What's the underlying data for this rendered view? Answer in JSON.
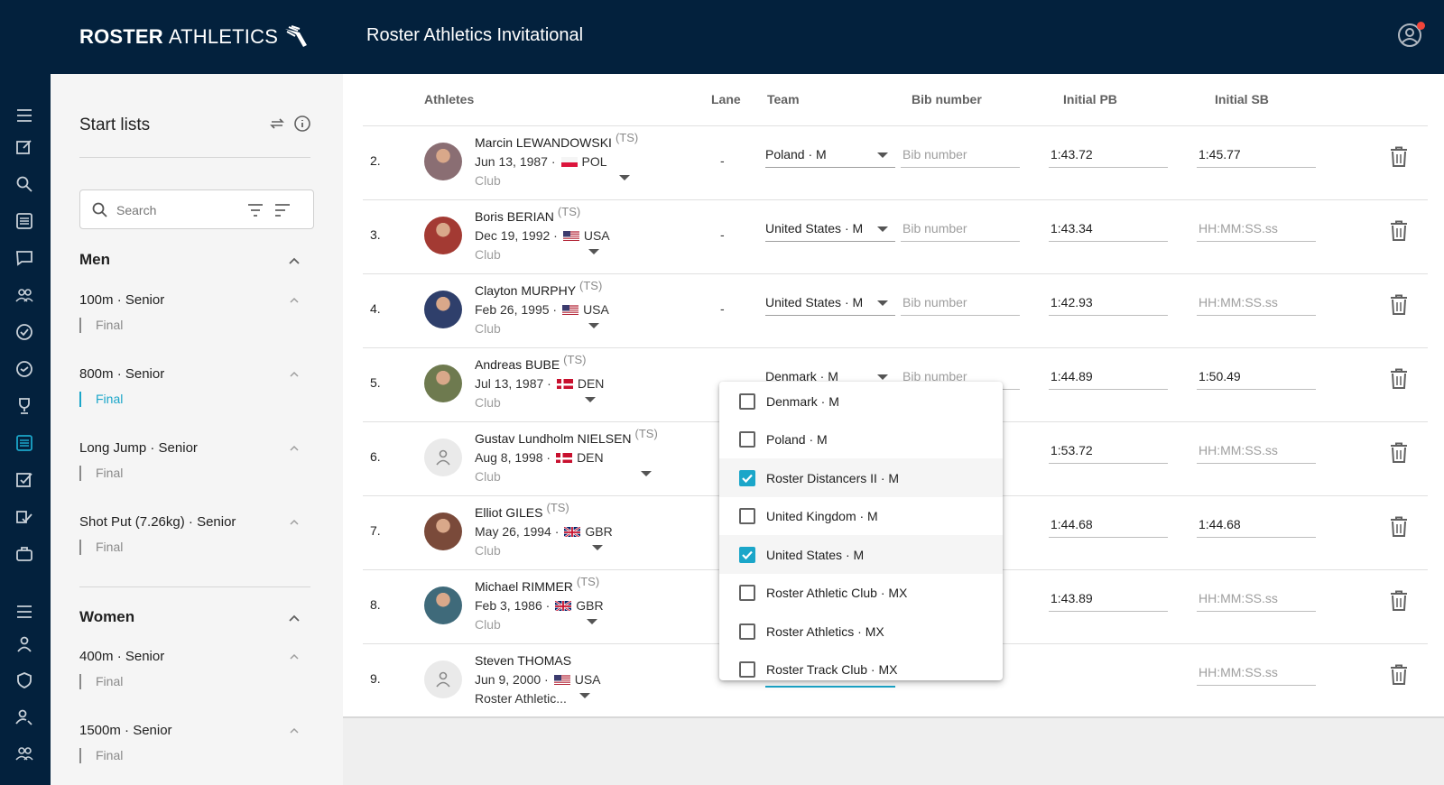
{
  "brand": {
    "bold": "ROSTER",
    "light": "ATHLETICS"
  },
  "app_title": "Roster Athletics Invitational",
  "rail_icons": [
    "menu-icon",
    "edit-icon",
    "search-icon",
    "list-icon",
    "chat-icon",
    "group-icon",
    "check-circle-icon",
    "check-circle-outline-icon",
    "trophy-icon",
    "startlist-icon",
    "checkbox-icon",
    "checklist-icon",
    "briefcase-icon",
    "menu-icon",
    "person-icon",
    "shield-icon",
    "user-search-icon",
    "group-icon"
  ],
  "panel": {
    "title": "Start lists",
    "search_placeholder": "Search",
    "groups": [
      {
        "title": "Men",
        "events": [
          {
            "title": "100m · Senior",
            "round": "Final",
            "active": false
          },
          {
            "title": "800m · Senior",
            "round": "Final",
            "active": true
          },
          {
            "title": "Long Jump · Senior",
            "round": "Final",
            "active": false
          },
          {
            "title": "Shot Put (7.26kg) · Senior",
            "round": "Final",
            "active": false
          }
        ]
      },
      {
        "title": "Women",
        "events": [
          {
            "title": "400m · Senior",
            "round": "Final",
            "active": false
          },
          {
            "title": "1500m · Senior",
            "round": "Final",
            "active": false
          }
        ]
      }
    ]
  },
  "table": {
    "headers": {
      "athletes": "Athletes",
      "lane": "Lane",
      "team": "Team",
      "bib": "Bib number",
      "pb": "Initial PB",
      "sb": "Initial SB"
    },
    "bib_placeholder": "Bib number",
    "time_placeholder": "HH:MM:SS.ss",
    "rows": [
      {
        "num": "2.",
        "name": "Marcin LEWANDOWSKI",
        "ts": "(TS)",
        "dob": "Jun 13, 1987 ·",
        "country": "POL",
        "flag": "pol",
        "club": "Club",
        "lane": "-",
        "team": "Poland · M",
        "bib": "",
        "pb": "1:43.72",
        "sb": "1:45.77",
        "avatar": "photo",
        "avatar_color": "#8a6e73"
      },
      {
        "num": "3.",
        "name": "Boris BERIAN",
        "ts": "(TS)",
        "dob": "Dec 19, 1992 ·",
        "country": "USA",
        "flag": "usa",
        "club": "Club",
        "lane": "-",
        "team": "United States · M",
        "bib": "",
        "pb": "1:43.34",
        "sb": "",
        "avatar": "photo",
        "avatar_color": "#a33a33"
      },
      {
        "num": "4.",
        "name": "Clayton MURPHY",
        "ts": "(TS)",
        "dob": "Feb 26, 1995 ·",
        "country": "USA",
        "flag": "usa",
        "club": "Club",
        "lane": "-",
        "team": "United States · M",
        "bib": "",
        "pb": "1:42.93",
        "sb": "",
        "avatar": "photo",
        "avatar_color": "#2f3f6b"
      },
      {
        "num": "5.",
        "name": "Andreas BUBE",
        "ts": "(TS)",
        "dob": "Jul 13, 1987 ·",
        "country": "DEN",
        "flag": "den",
        "club": "Club",
        "lane": "-",
        "team": "Denmark · M",
        "bib": "",
        "pb": "1:44.89",
        "sb": "1:50.49",
        "avatar": "photo",
        "avatar_color": "#6e7a4f"
      },
      {
        "num": "6.",
        "name": "Gustav Lundholm NIELSEN",
        "ts": "(TS)",
        "dob": "Aug 8, 1998 ·",
        "country": "DEN",
        "flag": "den",
        "club": "Club",
        "lane": "",
        "team": "",
        "bib": "",
        "pb": "1:53.72",
        "sb": "",
        "avatar": "placeholder",
        "avatar_color": "#eaeaea"
      },
      {
        "num": "7.",
        "name": "Elliot GILES",
        "ts": "(TS)",
        "dob": "May 26, 1994 ·",
        "country": "GBR",
        "flag": "gbr",
        "club": "Club",
        "lane": "",
        "team": "",
        "bib": "",
        "pb": "1:44.68",
        "sb": "1:44.68",
        "avatar": "photo",
        "avatar_color": "#7a4a3a"
      },
      {
        "num": "8.",
        "name": "Michael RIMMER",
        "ts": "(TS)",
        "dob": "Feb 3, 1986 ·",
        "country": "GBR",
        "flag": "gbr",
        "club": "Club",
        "lane": "",
        "team": "",
        "bib": "",
        "pb": "1:43.89",
        "sb": "",
        "avatar": "photo",
        "avatar_color": "#3f6a7a"
      },
      {
        "num": "9.",
        "name": "Steven THOMAS",
        "ts": "",
        "dob": "Jun 9, 2000 ·",
        "country": "USA",
        "flag": "usa",
        "club": "Roster Athletic...",
        "lane": "",
        "team": "",
        "bib": "",
        "pb": "",
        "sb": "",
        "avatar": "placeholder",
        "avatar_color": "#eaeaea"
      }
    ]
  },
  "team_dropdown": {
    "options": [
      {
        "label": "Denmark · M",
        "checked": false
      },
      {
        "label": "Poland · M",
        "checked": false
      },
      {
        "label": "Roster Distancers II · M",
        "checked": true
      },
      {
        "label": "United Kingdom · M",
        "checked": false
      },
      {
        "label": "United States · M",
        "checked": true
      },
      {
        "label": "Roster Athletic Club · MX",
        "checked": false
      },
      {
        "label": "Roster Athletics · MX",
        "checked": false
      },
      {
        "label": "Roster Track Club · MX",
        "checked": false
      }
    ]
  },
  "colors": {
    "topbar": "#03213d",
    "accent": "#1ba6c9",
    "notification": "#f0453a"
  }
}
